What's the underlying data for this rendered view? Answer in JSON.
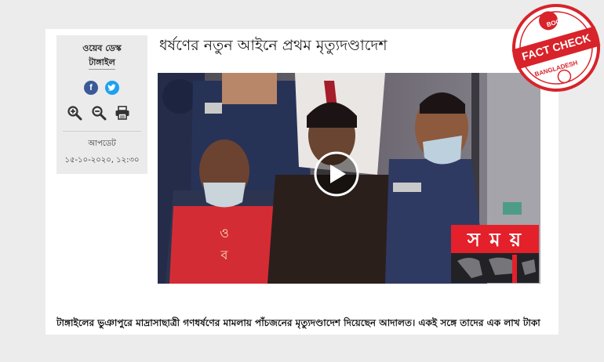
{
  "article": {
    "headline": "ধর্ষণের নতুন আইনে প্রথম মৃত্যুদণ্ডাদেশ",
    "lede": "টাঙ্গাইলের ভুঞাপুরে মাদ্রাসাছাত্রী গণধর্ষণের মামলায় পাঁচজনের মৃত্যুদণ্ডাদেশ দিয়েছেন আদালত। একই সঙ্গে তাদের এক লাখ টাকা"
  },
  "sidebar": {
    "author_dept": "ওয়েব ডেস্ক",
    "author_location": "টাঙ্গাইল",
    "facebook_glyph": "f",
    "updated_label": "আপডেট",
    "updated_time": "১৫-১০-২০২০, ১২:৩০",
    "icons": [
      "facebook-icon",
      "twitter-icon",
      "zoom-in-icon",
      "zoom-out-icon",
      "print-icon"
    ]
  },
  "video": {
    "channel_logo": "স ম য়",
    "player_icon": "play-icon"
  },
  "stamp": {
    "top": "BOOM",
    "middle": "FACT CHECK",
    "bottom": "BANGLADESH"
  },
  "colors": {
    "background": "#ececec",
    "stamp_red": "#d8232a",
    "logo_red": "#e4202a",
    "facebook": "#3b5998",
    "twitter": "#1da1f2"
  }
}
